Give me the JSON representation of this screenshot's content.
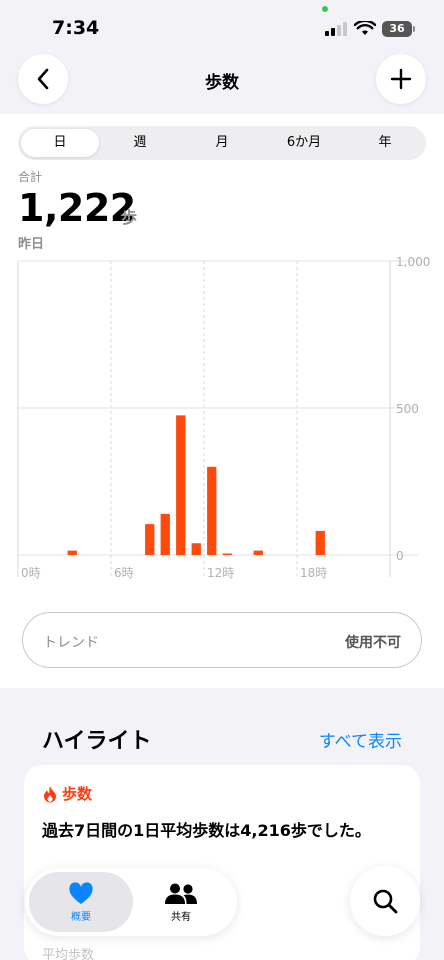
{
  "status_bar": {
    "time": "7:34",
    "battery": "36"
  },
  "nav": {
    "title": "歩数"
  },
  "segments": [
    {
      "label": "日",
      "active": true
    },
    {
      "label": "週",
      "active": false
    },
    {
      "label": "月",
      "active": false
    },
    {
      "label": "6か月",
      "active": false
    },
    {
      "label": "年",
      "active": false
    }
  ],
  "summary": {
    "label": "合計",
    "value": "1,222",
    "unit": "歩",
    "date": "昨日"
  },
  "chart_data": {
    "type": "bar",
    "x_tick_labels": [
      "0時",
      "6時",
      "12時",
      "18時"
    ],
    "y_tick_labels": [
      "1,000",
      "500",
      "0"
    ],
    "ylim": [
      0,
      1000
    ],
    "xlim": [
      0,
      24
    ],
    "hours": [
      3,
      8,
      9,
      10,
      11,
      12,
      13,
      15,
      19
    ],
    "values": [
      15,
      105,
      140,
      475,
      40,
      300,
      5,
      15,
      82
    ],
    "bar_color": "#ff4a0d",
    "grid": true
  },
  "trend": {
    "label": "トレンド",
    "value": "使用不可"
  },
  "highlights": {
    "title": "ハイライト",
    "see_all": "すべて表示",
    "card_title": "歩数",
    "card_text": "過去7日間の1日平均歩数は4,216歩でした。",
    "sub_label": "平均歩数"
  },
  "tabs": [
    {
      "label": "概要",
      "active": true
    },
    {
      "label": "共有",
      "active": false
    }
  ],
  "colors": {
    "accent": "#0a84ff",
    "steps": "#ff4a0d"
  }
}
